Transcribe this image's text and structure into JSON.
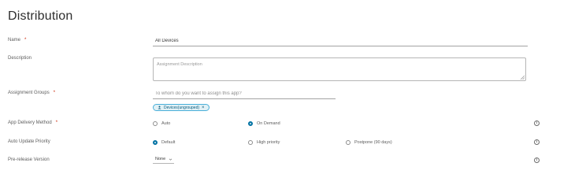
{
  "page": {
    "title": "Distribution"
  },
  "fields": {
    "name": {
      "label": "Name",
      "required_mark": "*",
      "value": "All Devices"
    },
    "description": {
      "label": "Description",
      "placeholder": "Assignment Description"
    },
    "assignment_groups": {
      "label": "Assignment Groups",
      "required_mark": "*",
      "placeholder": "To whom do you want to assign this app?",
      "chips": [
        {
          "label": "Devices(ungrouped)"
        }
      ]
    },
    "app_delivery_method": {
      "label": "App Delivery Method",
      "required_mark": "*",
      "options": [
        {
          "label": "Auto",
          "checked": false
        },
        {
          "label": "On Demand",
          "checked": true
        }
      ]
    },
    "auto_update_priority": {
      "label": "Auto Update Priority",
      "options": [
        {
          "label": "Default",
          "checked": true
        },
        {
          "label": "High priority",
          "checked": false
        },
        {
          "label": "Postpone (90 days)",
          "checked": false
        }
      ]
    },
    "pre_release_version": {
      "label": "Pre-release Version",
      "value": "None"
    }
  },
  "icons": {
    "info": "info-circle-icon",
    "chevron": "chevron-down-icon",
    "close": "close-icon",
    "group": "group-icon"
  },
  "colors": {
    "accent": "#0072a3",
    "chip_border": "#49afd9",
    "chip_bg": "#e1f1f6",
    "required": "#c92100"
  }
}
